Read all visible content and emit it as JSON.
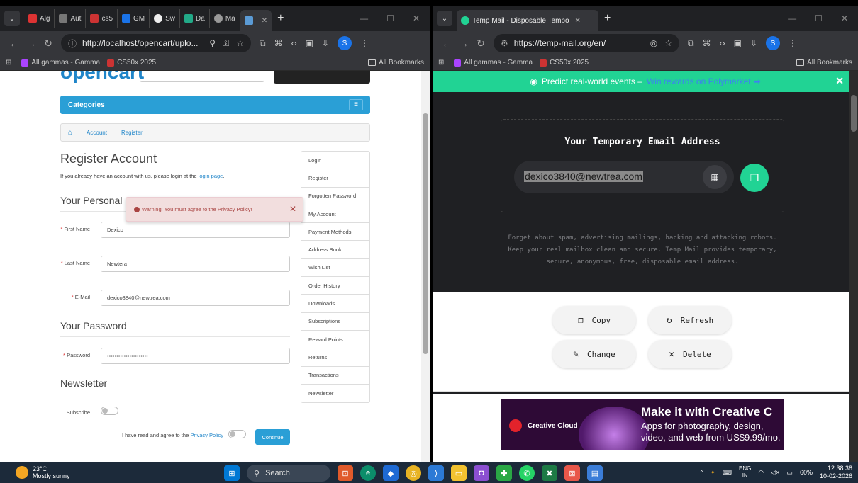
{
  "left_window": {
    "tabs": [
      {
        "label": "Alg",
        "color": "#d33"
      },
      {
        "label": "Aut",
        "color": "#888"
      },
      {
        "label": "cs5",
        "color": "#c33"
      },
      {
        "label": "GM",
        "color": "#1a73e8"
      },
      {
        "label": "Sw",
        "color": "#fff"
      },
      {
        "label": "Da",
        "color": "#2a8"
      },
      {
        "label": "Ma",
        "color": "#999"
      },
      {
        "label": "",
        "color": "#5b9bd5"
      }
    ],
    "url": "http://localhost/opencart/uplo...",
    "profile_initial": "S",
    "bookmarks": [
      "All gammas - Gamma",
      "CS50x 2025"
    ],
    "all_bookmarks": "All Bookmarks",
    "page": {
      "categories": "Categories",
      "breadcrumb": [
        "Account",
        "Register"
      ],
      "title": "Register Account",
      "subtitle_pre": "If you already have an account with us, please login at the ",
      "subtitle_link": "login page",
      "subtitle_post": ".",
      "section_personal": "Your Personal",
      "alert": "Warning: You must agree to the Privacy Policy!",
      "first_name_label": "First Name",
      "first_name_value": "Dexico",
      "last_name_label": "Last Name",
      "last_name_value": "Newtera",
      "email_label": "E-Mail",
      "email_value": "dexico3840@newtrea.com",
      "section_password": "Your Password",
      "password_label": "Password",
      "password_value": "••••••••••••••••••••••",
      "section_newsletter": "Newsletter",
      "subscribe_label": "Subscribe",
      "agree_pre": "I have read and agree to the ",
      "agree_link": "Privacy Policy",
      "continue": "Continue",
      "sidebar": [
        "Login",
        "Register",
        "Forgotten Password",
        "My Account",
        "Payment Methods",
        "Address Book",
        "Wish List",
        "Order History",
        "Downloads",
        "Subscriptions",
        "Reward Points",
        "Returns",
        "Transactions",
        "Newsletter"
      ]
    }
  },
  "right_window": {
    "tab_title": "Temp Mail - Disposable Tempo",
    "url": "https://temp-mail.org/en/",
    "profile_initial": "S",
    "bookmarks": [
      "All gammas - Gamma",
      "CS50x 2025"
    ],
    "all_bookmarks": "All Bookmarks",
    "page": {
      "promo_text": "Predict real-world events –",
      "promo_link": "Win rewards on Polymarket",
      "box_title": "Your Temporary Email Address",
      "email": "dexico3840@newtrea.com",
      "description": "Forget about spam, advertising mailings, hacking and attacking robots. Keep your real mailbox clean and secure. Temp Mail provides temporary, secure, anonymous, free, disposable email address.",
      "actions": [
        "Copy",
        "Refresh",
        "Change",
        "Delete"
      ],
      "ad": {
        "brand": "Creative Cloud",
        "headline": "Make it with Creative C",
        "line1": "Apps for photography, design,",
        "line2": "video, and web from US$9.99/mo."
      }
    }
  },
  "taskbar": {
    "temperature": "23°C",
    "condition": "Mostly sunny",
    "search": "Search",
    "lang1": "ENG",
    "lang2": "IN",
    "battery": "60%",
    "time": "12:38:38",
    "date": "10-02-2026"
  }
}
